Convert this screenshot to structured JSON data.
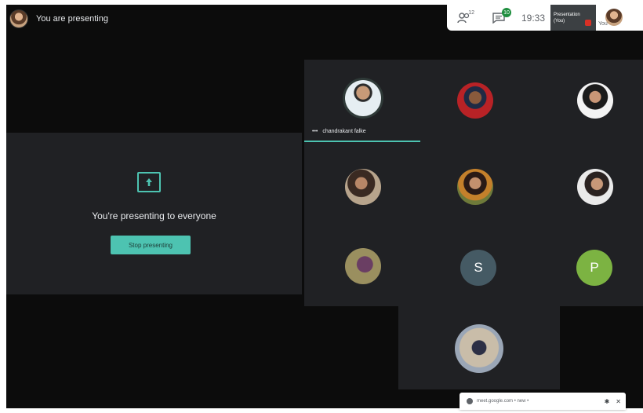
{
  "header": {
    "presenting_status": "You are presenting"
  },
  "topbar": {
    "people_count": "12",
    "chat_badge": "10",
    "time": "19:33",
    "presentation_line1": "Presentation",
    "presentation_line2": "(You)",
    "you_label": "You"
  },
  "present_panel": {
    "message": "You're presenting to everyone",
    "stop_label": "Stop presenting",
    "accent_color": "#4dc3b1"
  },
  "participants": {
    "speaker_name": "chandrakant falke",
    "letter_s": "S",
    "letter_p": "P",
    "letter_s_color": "#455a64",
    "letter_p_color": "#7cb342"
  },
  "popup": {
    "text": "meet.google.com • new •"
  },
  "icons": [
    "avatar",
    "people-icon",
    "chat-icon",
    "present-screen-icon",
    "arrow-up-icon",
    "more-icon",
    "pin-icon",
    "close-icon"
  ]
}
